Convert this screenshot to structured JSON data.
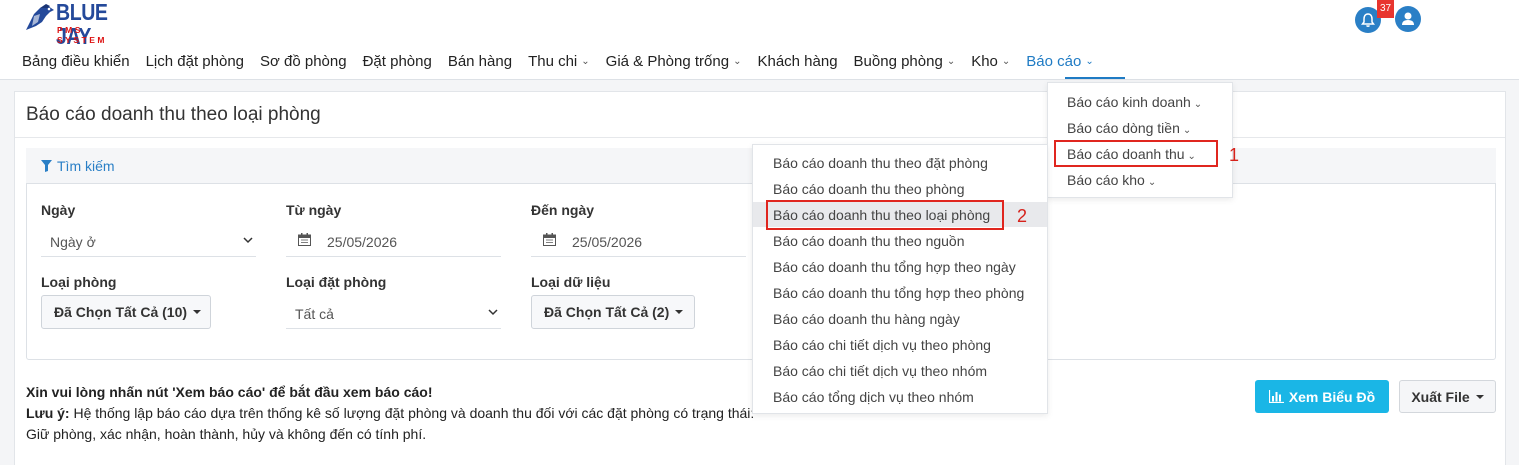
{
  "brand": {
    "name": "BLUE JAY",
    "tagline": "PMS SYSTEM"
  },
  "header": {
    "notification_count": "37"
  },
  "nav": {
    "items": [
      {
        "label": "Bảng điều khiển",
        "dropdown": false
      },
      {
        "label": "Lịch đặt phòng",
        "dropdown": false
      },
      {
        "label": "Sơ đồ phòng",
        "dropdown": false
      },
      {
        "label": "Đặt phòng",
        "dropdown": false
      },
      {
        "label": "Bán hàng",
        "dropdown": false
      },
      {
        "label": "Thu chi",
        "dropdown": true
      },
      {
        "label": "Giá & Phòng trống",
        "dropdown": true
      },
      {
        "label": "Khách hàng",
        "dropdown": false
      },
      {
        "label": "Buồng phòng",
        "dropdown": true
      },
      {
        "label": "Kho",
        "dropdown": true
      },
      {
        "label": "Báo cáo",
        "dropdown": true,
        "active": true
      }
    ]
  },
  "page": {
    "title": "Báo cáo doanh thu theo loại phòng"
  },
  "search": {
    "title": "Tìm kiếm",
    "ngay": {
      "label": "Ngày",
      "value": "Ngày ở"
    },
    "tu_ngay": {
      "label": "Từ ngày",
      "value": "25/05/2026"
    },
    "den_ngay": {
      "label": "Đến ngày",
      "value": "25/05/2026"
    },
    "loai_phong": {
      "label": "Loại phòng",
      "value": "Đã Chọn Tất Cả (10)"
    },
    "loai_dat_phong": {
      "label": "Loại đặt phòng",
      "value": "Tất cả"
    },
    "loai_du_lieu": {
      "label": "Loại dữ liệu",
      "value": "Đã Chọn Tất Cả (2)"
    }
  },
  "notice": {
    "line1": "Xin vui lòng nhấn nút 'Xem báo cáo' để bắt đầu xem báo cáo!",
    "note_label": "Lưu ý:",
    "line2": " Hệ thống lập báo cáo dựa trên thống kê số lượng đặt phòng và doanh thu đối với các đặt phòng có trạng thái:",
    "line3": "Giữ phòng, xác nhận, hoàn thành, hủy và không đến có tính phí."
  },
  "buttons": {
    "chart": "Xem Biểu Đồ",
    "export": "Xuất File"
  },
  "report_menu": {
    "items": [
      "Báo cáo kinh doanh",
      "Báo cáo dòng tiền",
      "Báo cáo doanh thu",
      "Báo cáo kho"
    ],
    "annotation": "1"
  },
  "revenue_menu": {
    "items": [
      "Báo cáo doanh thu theo đặt phòng",
      "Báo cáo doanh thu theo phòng",
      "Báo cáo doanh thu theo loại phòng",
      "Báo cáo doanh thu theo nguồn",
      "Báo cáo doanh thu tổng hợp theo ngày",
      "Báo cáo doanh thu tổng hợp theo phòng",
      "Báo cáo doanh thu hàng ngày",
      "Báo cáo chi tiết dịch vụ theo phòng",
      "Báo cáo chi tiết dịch vụ theo nhóm",
      "Báo cáo tổng dịch vụ theo nhóm"
    ],
    "annotation": "2"
  },
  "colors": {
    "primary": "#1f7bc4",
    "accent": "#1ab6e6",
    "badge": "#e8352f",
    "annotation": "#e0261f"
  }
}
